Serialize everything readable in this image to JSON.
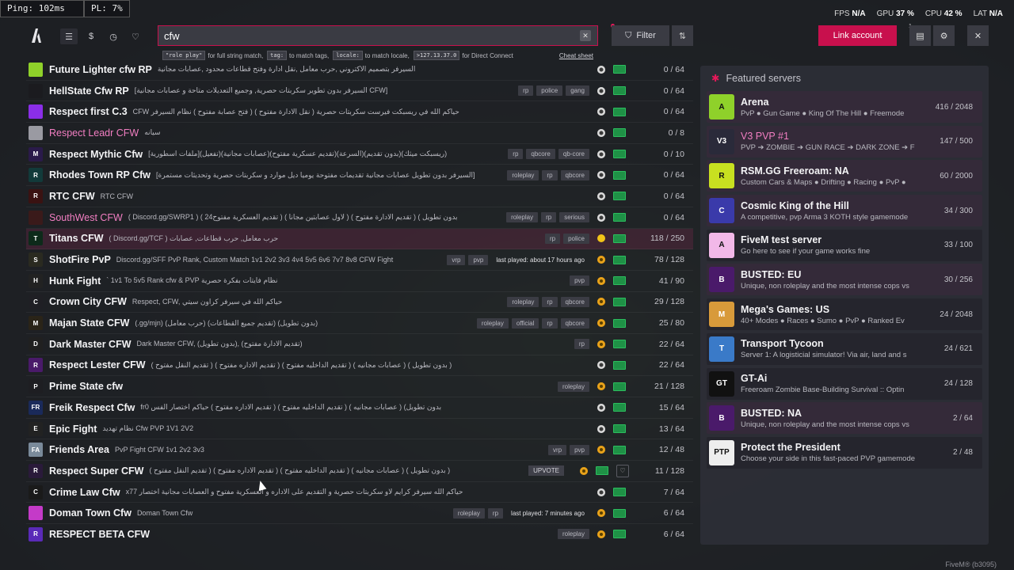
{
  "overlay": {
    "ping": "Ping: 102ms",
    "pl": "PL: 7%"
  },
  "stats": {
    "fps_label": "FPS",
    "fps": "N/A",
    "gpu_label": "GPU",
    "gpu": "37 %",
    "cpu_label": "CPU",
    "cpu": "42 %",
    "lat_label": "LAT",
    "lat": "N/A"
  },
  "nav": {
    "items": [
      "list-icon",
      "dollar-icon",
      "history-icon",
      "heart-icon"
    ]
  },
  "search": {
    "value": "cfw",
    "clear": "✕",
    "hint": {
      "c1": "\"role play\"",
      "t1": "for full string match,",
      "c2": "tag:",
      "t2": "to match tags,",
      "c3": "locale:",
      "t3": "to match locale,",
      "c4": ">127.13.37.0",
      "t4": "for Direct Connect",
      "cheat": "Cheat sheet"
    }
  },
  "toolbar": {
    "filter": "Filter",
    "link_account": "Link account",
    "badge": "1"
  },
  "servers": [
    {
      "name": "Future Lighter cfw RP",
      "desc": "السيرفر بتصميم الاكتروني ,حرب معامل ,نقل ادارة وفتح قطاعات محدود ,عصابات مجانية",
      "tags": [],
      "played": "",
      "status": "w",
      "count": "0 / 64",
      "icon": "#8fd12a",
      "ilabel": ""
    },
    {
      "name": "HellState Cfw RP",
      "desc": "[السيرفر بدون تطوير سكربتات حصرية, وجميع التعديلات متاحة و عصابات مجانية CFW]",
      "tags": [
        "rp",
        "police",
        "gang"
      ],
      "played": "",
      "status": "w",
      "count": "0 / 64",
      "icon": "#1b1b1f",
      "ilabel": ""
    },
    {
      "name": "Respect first C.3",
      "desc": "CFW حياكم الله في ريسبكت فيرست سكربتات حصرية ( نقل الادارة مفتوح ) ( فتح عصابة مفتوح ) نظام السيرفر",
      "tags": [],
      "played": "",
      "status": "w",
      "count": "0 / 64",
      "icon": "#8b2ee8",
      "ilabel": ""
    },
    {
      "name": "Respect Leadr CFW",
      "desc": "سيانه",
      "tags": [],
      "played": "",
      "status": "w",
      "count": "0 / 8",
      "icon": "#9a9aa2",
      "ilabel": "",
      "pink": true
    },
    {
      "name": "Respect Mythic Cfw",
      "desc": "[ملفات اسطورية](تفعيل)(عصابات مجانية)(تقديم عسكرية مفتوح)(السرعة)(بدون تقديم)(ريسبكت ميثك)",
      "tags": [
        "rp",
        "qbcore",
        "qb-core"
      ],
      "played": "",
      "status": "w",
      "count": "0 / 10",
      "icon": "#2a1a4a",
      "ilabel": "M"
    },
    {
      "name": "Rhodes Town RP Cfw",
      "desc": "[السيرفر بدون تطويل عصابات مجانية تقديمات مفتوحة يوميا ديل موارد و سكربتات حصرية وتحديثات مستمرة]",
      "tags": [
        "roleplay",
        "rp",
        "qbcore"
      ],
      "played": "",
      "status": "w",
      "count": "0 / 64",
      "icon": "#123a3a",
      "ilabel": "R"
    },
    {
      "name": "RTC CFW",
      "desc": "RTC CFW",
      "tags": [],
      "played": "",
      "status": "w",
      "count": "0 / 64",
      "icon": "#3a1212",
      "ilabel": "R"
    },
    {
      "name": "SouthWest CFW",
      "desc": "( Discord.gg/SWRP1 ) ( تقديم العسكرية مفتوح24 ) ( لاول عصابتين مجانا ) ( تقديم الادارة مفتوح ) ( بدون تطويل",
      "tags": [
        "roleplay",
        "rp",
        "serious"
      ],
      "played": "",
      "status": "w",
      "count": "0 / 64",
      "icon": "#3a1a1a",
      "ilabel": "",
      "pink": true
    },
    {
      "name": "Titans CFW",
      "desc": "( Discord.gg/TCF ) حرب معامل, حرب قطاعات, عصابات",
      "tags": [
        "rp",
        "police"
      ],
      "played": "",
      "status": "sun",
      "count": "118 / 250",
      "icon": "#0d2a1a",
      "ilabel": "T",
      "hl": true
    },
    {
      "name": "ShotFire PvP",
      "desc": "Discord.gg/SFF PvP Rank, Custom Match 1v1 2v2 3v3 4v4 5v5 6v6 7v7 8v8 CFW Fight",
      "tags": [
        "vrp",
        "pvp"
      ],
      "played": "last played: about 17 hours ago",
      "status": "o",
      "count": "78 / 128",
      "icon": "#2a2a20",
      "ilabel": "S"
    },
    {
      "name": "Hunk Fight",
      "desc": "` 1v1 To 5v5 Rank cfw & PVP نظام فايتات بفكرة حصرية",
      "tags": [
        "pvp"
      ],
      "played": "",
      "status": "o",
      "count": "41 / 90",
      "icon": "#222",
      "ilabel": "H"
    },
    {
      "name": "Crown City CFW",
      "desc": "Respect, CFW, حياكم الله في سيرفر كراون سيتي",
      "tags": [
        "roleplay",
        "rp",
        "qbcore"
      ],
      "played": "",
      "status": "o",
      "count": "29 / 128",
      "icon": "#1f1f24",
      "ilabel": "C"
    },
    {
      "name": "Majan State CFW",
      "desc": "(.gg/mjn) (حرب معامل) (تقديم جميع القطاعات) (بدون تطويل)",
      "tags": [
        "roleplay",
        "official",
        "rp",
        "qbcore"
      ],
      "played": "",
      "status": "o",
      "count": "25 / 80",
      "icon": "#2a2418",
      "ilabel": "M"
    },
    {
      "name": "Dark Master CFW",
      "desc": "Dark Master CFW, (بدون تطويل), (تقديم الادارة مفتوح)",
      "tags": [
        "rp"
      ],
      "played": "",
      "status": "o",
      "count": "22 / 64",
      "icon": "#202020",
      "ilabel": "D"
    },
    {
      "name": "Respect Lester CFW",
      "desc": "( تقديم النقل مفتوح ) ( تقديم الاداره مفتوح ) ( تقديم الداخليه مفتوح ) ( عصابات مجانيه ) ( بدون تطويل )",
      "tags": [],
      "played": "",
      "status": "w",
      "count": "22 / 64",
      "icon": "#4a1a6a",
      "ilabel": "R"
    },
    {
      "name": "Prime State cfw",
      "desc": "",
      "tags": [
        "roleplay"
      ],
      "played": "",
      "status": "o",
      "count": "21 / 128",
      "icon": "#1e1e22",
      "ilabel": "P"
    },
    {
      "name": "Freik Respect Cfw",
      "desc": "fr0 بدون تطويل) ( عصابات مجانيه ) ( تقديم الداخليه مفتوح ) ( تقديم الاداره مفتوح ) حياكم اختصار الفس",
      "tags": [],
      "played": "",
      "status": "w",
      "count": "15 / 64",
      "icon": "#1a2a5a",
      "ilabel": "FR"
    },
    {
      "name": "Epic Fight",
      "desc": "نظام تهديد Cfw PVP 1V1 2V2",
      "tags": [],
      "played": "",
      "status": "w",
      "count": "13 / 64",
      "icon": "#222",
      "ilabel": "E"
    },
    {
      "name": "Friends Area",
      "desc": "PvP Fight CFW 1v1 2v2 3v3",
      "tags": [
        "vrp",
        "pvp"
      ],
      "played": "",
      "status": "o",
      "count": "12 / 48",
      "icon": "#7a8a9a",
      "ilabel": "FA"
    },
    {
      "name": "Respect Super CFW",
      "desc": "( تقديم النقل مفتوح ) ( تقديم الاداره مفتوح ) ( تقديم الداخليه مفتوح ) ( عصابات مجانيه ) ( بدون تطويل )",
      "tags": [],
      "played": "",
      "status": "o",
      "count": "11 / 128",
      "icon": "#2a1a3a",
      "ilabel": "R",
      "upvote": "UPVOTE",
      "heart": true
    },
    {
      "name": "Crime Law Cfw",
      "desc": "x77 حياكم الله سيرفر كرايم لاو سكربتات حصرية و التقديم على الاداره و العسكرية مفتوح و العصابات مجانية اختصار",
      "tags": [],
      "played": "",
      "status": "w",
      "count": "7 / 64",
      "icon": "#1a1a1a",
      "ilabel": "C"
    },
    {
      "name": "Doman Town Cfw",
      "desc": "Doman Town Cfw",
      "tags": [
        "roleplay",
        "rp"
      ],
      "played": "last played: 7 minutes ago",
      "status": "o",
      "count": "6 / 64",
      "icon": "#c43ac8",
      "ilabel": ""
    },
    {
      "name": "RESPECT BETA CFW",
      "desc": "",
      "tags": [
        "roleplay"
      ],
      "played": "",
      "status": "o",
      "count": "6 / 64",
      "icon": "#5a2ab8",
      "ilabel": "R"
    }
  ],
  "featured": {
    "title": "Featured servers",
    "items": [
      {
        "name": "Arena",
        "desc": "PvP ● Gun Game ● King Of The Hill ● Freemode",
        "count": "416 / 2048",
        "color": "#8fd12a",
        "label": "A"
      },
      {
        "name": "V3 PVP #1",
        "desc": "PVP ➔ ZOMBIE ➔ GUN RACE ➔ DARK ZONE ➔ F",
        "count": "147 / 500",
        "color": "#2a2a3a",
        "label": "V3",
        "pink": true
      },
      {
        "name": "RSM.GG Freeroam: NA",
        "desc": "Custom Cars & Maps ● Drifting ● Racing ● PvP ●",
        "count": "60 / 2000",
        "color": "#c8e020",
        "label": "R"
      },
      {
        "name": "Cosmic King of the Hill",
        "desc": "A competitive, pvp Arma 3 KOTH style gamemode",
        "count": "34 / 300",
        "color": "#3a3aaa",
        "label": "C"
      },
      {
        "name": "FiveM test server",
        "desc": "Go here to see if your game works fine",
        "count": "33 / 100",
        "color": "#f2b8e8",
        "label": "A"
      },
      {
        "name": "BUSTED: EU",
        "desc": "Unique, non roleplay and the most intense cops vs",
        "count": "30 / 256",
        "color": "#4a1a6a",
        "label": "B"
      },
      {
        "name": "Mega's Games: US",
        "desc": "40+ Modes ● Races ● Sumo ● PvP ● Ranked Ev",
        "count": "24 / 2048",
        "color": "#d89a3a",
        "label": "M"
      },
      {
        "name": "Transport Tycoon",
        "desc": "Server 1: A logisticial simulator! Via air, land and s",
        "count": "24 / 621",
        "color": "#3a7ac8",
        "label": "T"
      },
      {
        "name": "GT-Ai",
        "desc": "Freeroam Zombie Base-Building Survival :: Optin",
        "count": "24 / 128",
        "color": "#111",
        "label": "GT"
      },
      {
        "name": "BUSTED: NA",
        "desc": "Unique, non roleplay and the most intense cops vs",
        "count": "2 / 64",
        "color": "#4a1a6a",
        "label": "B"
      },
      {
        "name": "Protect the President",
        "desc": "Choose your side in this fast-paced PVP gamemode",
        "count": "2 / 48",
        "color": "#eee",
        "label": "PTP"
      }
    ]
  },
  "footer": {
    "fivem": "FiveM® (b3095)"
  }
}
